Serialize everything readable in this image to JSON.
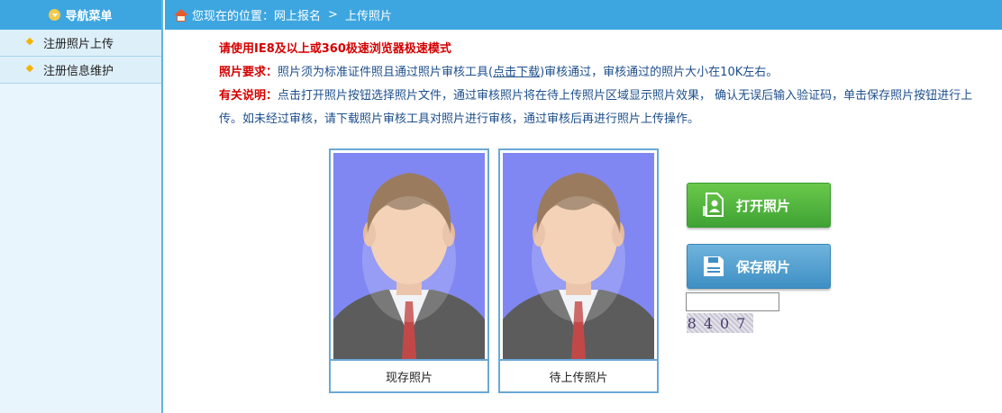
{
  "sidebar": {
    "title": "导航菜单",
    "items": [
      {
        "label": "注册照片上传"
      },
      {
        "label": "注册信息维护"
      }
    ]
  },
  "breadcrumb": {
    "prefix": "您现在的位置：",
    "level1": "网上报名",
    "separator": ">",
    "level2": "上传照片"
  },
  "notice": {
    "browser_tip": "请使用IE8及以上或360极速浏览器极速模式",
    "requirement_label": "照片要求：",
    "requirement_text_1": "照片须为标准证件照且通过照片审核工具(",
    "download_link": "点击下载",
    "requirement_text_2": ")审核通过，审核通过的照片大小在10K左右。",
    "explain_label": "有关说明：",
    "explain_text": "点击打开照片按钮选择照片文件，通过审核照片将在待上传照片区域显示照片效果， 确认无误后输入验证码，单击保存照片按钮进行上传。如未经过审核，请下载照片审核工具对照片进行审核，通过审核后再进行照片上传操作。"
  },
  "photos": {
    "current_caption": "现存照片",
    "pending_caption": "待上传照片"
  },
  "buttons": {
    "open_label": "打开照片",
    "save_label": "保存照片"
  },
  "captcha": {
    "input_value": "",
    "code": "8407"
  },
  "colors": {
    "header_blue": "#3da6e0",
    "notice_red": "#d40000",
    "text_blue": "#1e4f8c",
    "photo_bg": "#8087f2",
    "open_green": "#4fb53c",
    "save_blue": "#4a9bcf"
  }
}
